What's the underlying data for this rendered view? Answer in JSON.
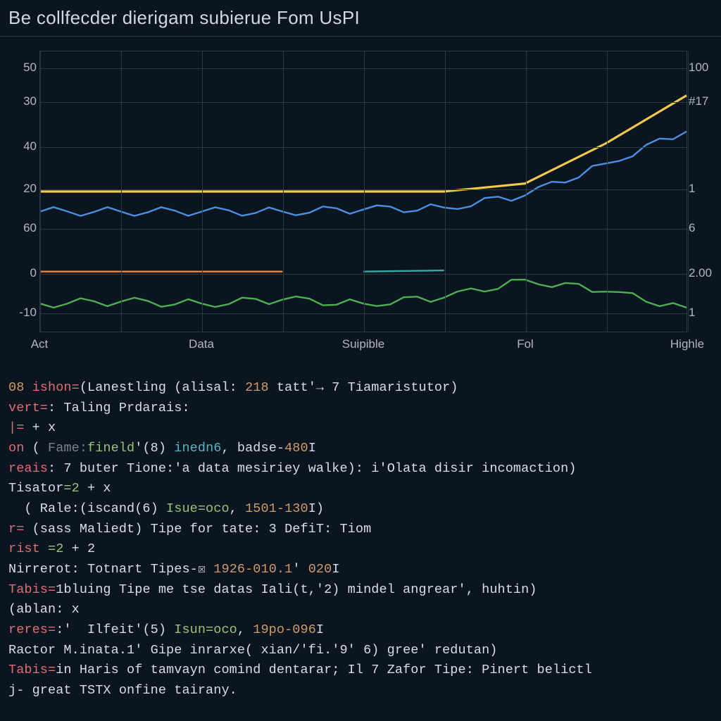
{
  "title": "Be collfecder dierigam subierue Fom UsPI",
  "chart_data": {
    "type": "line",
    "categories": [
      "Act",
      "",
      "Data",
      "",
      "Suipible",
      "",
      "Fol",
      "",
      "Highle"
    ],
    "x_indices": [
      0,
      1,
      2,
      3,
      4,
      5,
      6,
      7,
      8
    ],
    "y_ticks_left": [
      "50",
      "30",
      "40",
      "20",
      "60",
      "0",
      "-10"
    ],
    "y_ticks_right": [
      "100",
      "#17",
      "1",
      "6",
      "2.00",
      "1"
    ],
    "series": [
      {
        "name": "yellow",
        "color": "#f2c94c",
        "values": [
          20,
          20,
          20,
          20,
          20,
          20,
          22,
          32,
          44
        ]
      },
      {
        "name": "blue",
        "color": "#4a90e2",
        "values": [
          15,
          15,
          15,
          15,
          15.5,
          16,
          19,
          27,
          35
        ]
      },
      {
        "name": "orange-short",
        "color": "#e88b3a",
        "values": [
          0,
          0,
          0,
          0,
          null,
          null,
          null,
          null,
          null
        ]
      },
      {
        "name": "teal-short",
        "color": "#3aa7a7",
        "values": [
          null,
          null,
          null,
          null,
          0,
          0.3,
          null,
          null,
          null
        ]
      },
      {
        "name": "green",
        "color": "#4caf50",
        "values": [
          -8,
          -7.5,
          -8,
          -7,
          -8,
          -6.5,
          -2,
          -5,
          -9
        ]
      }
    ],
    "ylim_left": [
      -15,
      55
    ]
  },
  "console_lines": [
    [
      {
        "c": "num",
        "t": "08 "
      },
      {
        "c": "kw",
        "t": "ishon="
      },
      {
        "c": "white",
        "t": "(Lanestling (alisal: "
      },
      {
        "c": "num",
        "t": "218"
      },
      {
        "c": "white",
        "t": " tatt'→ 7 Tiamaristutor)"
      }
    ],
    [
      {
        "c": "kw",
        "t": "vert="
      },
      {
        "c": "white",
        "t": ": Taling Prdarais:"
      }
    ],
    [
      {
        "c": "kw",
        "t": "|= "
      },
      {
        "c": "white",
        "t": "+ x"
      }
    ],
    [
      {
        "c": "kw",
        "t": "on "
      },
      {
        "c": "white",
        "t": "( "
      },
      {
        "c": "gray",
        "t": "Fame:"
      },
      {
        "c": "green",
        "t": "fineld"
      },
      {
        "c": "white",
        "t": "'(8) "
      },
      {
        "c": "cyan",
        "t": "inedn6"
      },
      {
        "c": "white",
        "t": ", badse-"
      },
      {
        "c": "num",
        "t": "480"
      },
      {
        "c": "white",
        "t": "I"
      }
    ],
    [
      {
        "c": "kw",
        "t": "reais"
      },
      {
        "c": "white",
        "t": ": 7 buter Tione:'a data mesiriey walke): i'Olata disir incomaction)"
      }
    ],
    [
      {
        "c": "white",
        "t": "Tisator"
      },
      {
        "c": "green",
        "t": "=2"
      },
      {
        "c": "white",
        "t": " + x"
      }
    ],
    [
      {
        "c": "white",
        "t": "  ( Rale:(iscand(6) "
      },
      {
        "c": "green",
        "t": "Isue=oco"
      },
      {
        "c": "white",
        "t": ", "
      },
      {
        "c": "num",
        "t": "1501-130"
      },
      {
        "c": "white",
        "t": "I)"
      }
    ],
    [
      {
        "c": "kw",
        "t": "r= "
      },
      {
        "c": "white",
        "t": "(sass Maliedt) Tipe for tate: 3 DefiT: Tiom"
      }
    ],
    [
      {
        "c": "kw",
        "t": "rist "
      },
      {
        "c": "green",
        "t": "=2"
      },
      {
        "c": "white",
        "t": " + 2"
      }
    ],
    [
      {
        "c": "white",
        "t": "Nirrerot: Totnart Tipes-☒ "
      },
      {
        "c": "num",
        "t": "1926-010.1"
      },
      {
        "c": "white",
        "t": "' "
      },
      {
        "c": "num",
        "t": "020"
      },
      {
        "c": "white",
        "t": "I"
      }
    ],
    [
      {
        "c": "kw",
        "t": "Tabis="
      },
      {
        "c": "white",
        "t": "1bluing Tipe me tse datas Iali(t,'2) mindel angrear', huhtin)"
      }
    ],
    [
      {
        "c": "white",
        "t": "(ablan: x"
      }
    ],
    [
      {
        "c": "kw",
        "t": "reres="
      },
      {
        "c": "white",
        "t": ":'  Ilfeit'(5) "
      },
      {
        "c": "green",
        "t": "Isun=oco"
      },
      {
        "c": "white",
        "t": ", "
      },
      {
        "c": "num",
        "t": "19po-096"
      },
      {
        "c": "white",
        "t": "I"
      }
    ],
    [
      {
        "c": "white",
        "t": "Ractor M.inata.1' Gipe inrarxe( xian/'fi.'9' 6) gree' redutan)"
      }
    ],
    [
      {
        "c": "kw",
        "t": "Tabis="
      },
      {
        "c": "white",
        "t": "in Haris of tamvayn comind dentarar; Il 7 Zafor Tipe: Pinert belictl"
      }
    ],
    [
      {
        "c": "white",
        "t": "j- great TSTX onfine tairany."
      }
    ]
  ]
}
